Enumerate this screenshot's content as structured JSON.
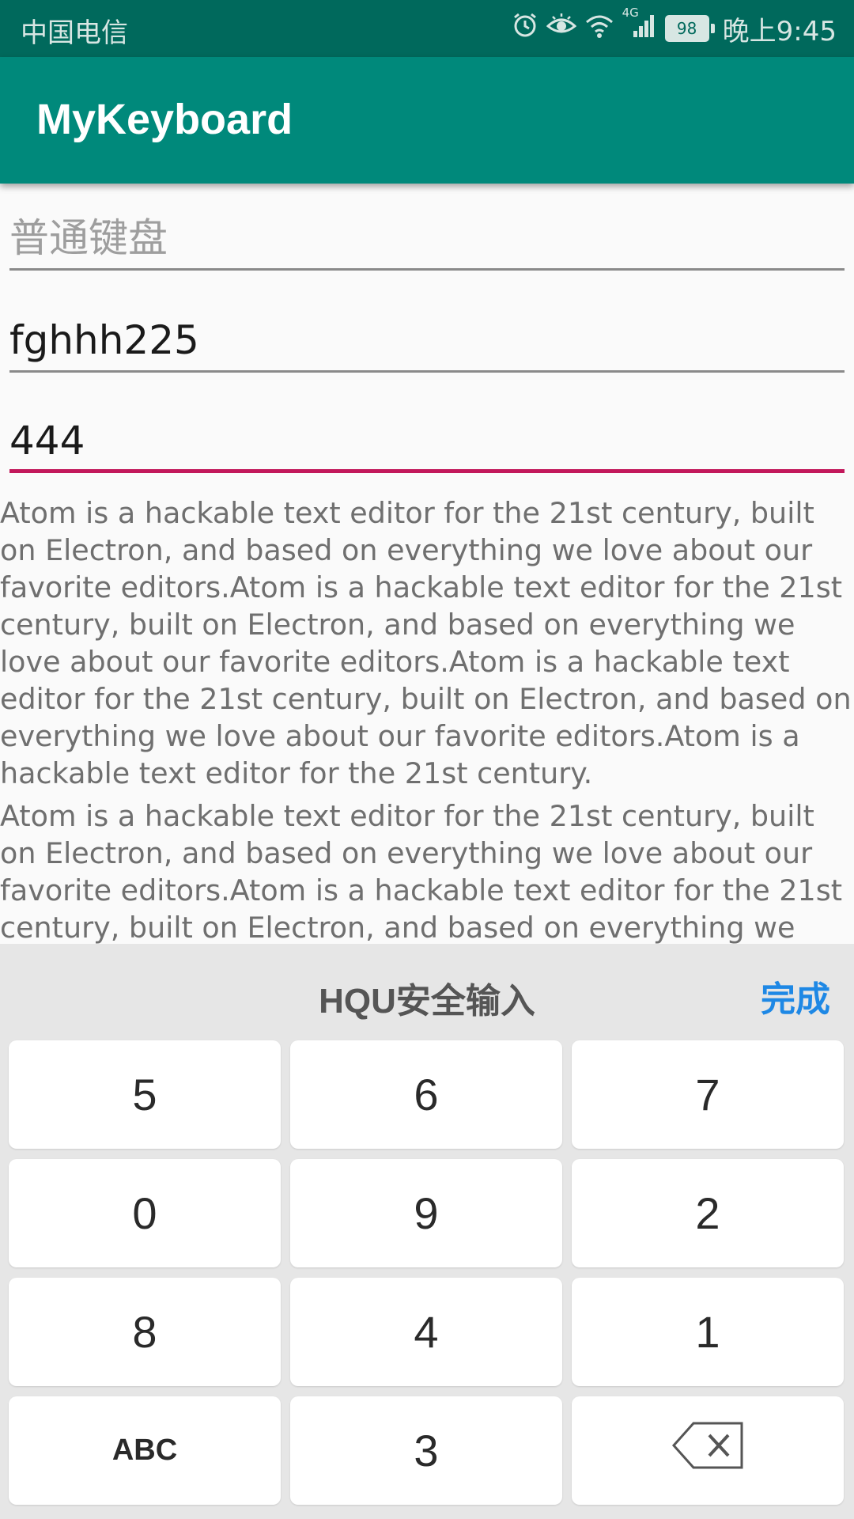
{
  "status_bar": {
    "carrier": "中国电信",
    "network": "4G",
    "battery": "98",
    "time": "晚上9:45"
  },
  "app_bar": {
    "title": "MyKeyboard"
  },
  "fields": {
    "normal": {
      "placeholder": "普通键盘",
      "value": ""
    },
    "text": {
      "value": "fghhh225"
    },
    "number": {
      "value": "444"
    }
  },
  "paragraphs": [
    "Atom is a hackable text editor for the 21st century, built on Electron, and based on everything we love about our favorite editors.Atom is a hackable text editor for the 21st century, built on Electron, and based on everything we love about our favorite editors.Atom is a hackable text editor for the 21st century, built on Electron, and based on everything we love about our favorite editors.Atom is a hackable text editor for the 21st century.",
    "Atom is a hackable text editor for the 21st century, built on Electron, and based on everything we love about our favorite editors.Atom is a hackable text editor for the 21st century, built on Electron, and based on everything we love about our"
  ],
  "keyboard": {
    "title": "HQU安全输入",
    "done": "完成",
    "keys": [
      "5",
      "6",
      "7",
      "0",
      "9",
      "2",
      "8",
      "4",
      "1",
      "ABC",
      "3"
    ],
    "delete_icon": "backspace-icon"
  },
  "colors": {
    "status_bar": "#00695c",
    "app_bar": "#00897b",
    "focus_underline": "#c2185b",
    "done": "#1e88e5"
  }
}
